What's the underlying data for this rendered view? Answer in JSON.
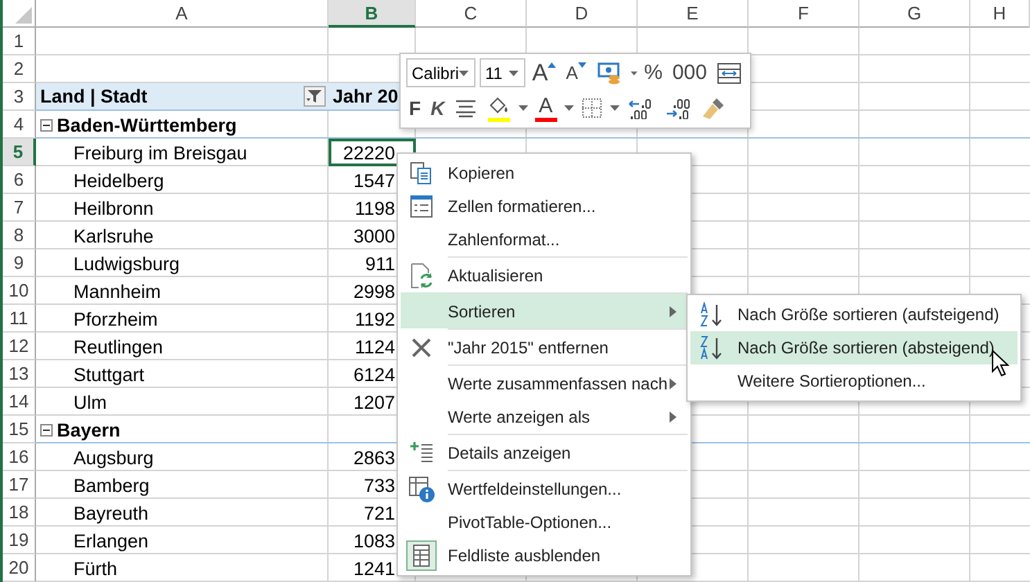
{
  "sheet": {
    "columns": [
      {
        "label": "A",
        "selected": false
      },
      {
        "label": "B",
        "selected": true
      },
      {
        "label": "C",
        "selected": false
      },
      {
        "label": "D",
        "selected": false
      },
      {
        "label": "E",
        "selected": false
      },
      {
        "label": "F",
        "selected": false
      },
      {
        "label": "G",
        "selected": false
      },
      {
        "label": "H",
        "selected": false
      }
    ],
    "rows": [
      {
        "number": "1",
        "kind": "blank",
        "selected": false
      },
      {
        "number": "2",
        "kind": "blank",
        "selected": false
      },
      {
        "number": "3",
        "kind": "header",
        "selected": false,
        "label": "Land | Stadt",
        "value": "Jahr 20"
      },
      {
        "number": "4",
        "kind": "group",
        "selected": false,
        "label": "Baden-Württemberg",
        "expanded": true
      },
      {
        "number": "5",
        "kind": "item",
        "selected": true,
        "label": "Freiburg im Breisgau",
        "value": "22220"
      },
      {
        "number": "6",
        "kind": "item",
        "selected": false,
        "label": "Heidelberg",
        "value": "1547"
      },
      {
        "number": "7",
        "kind": "item",
        "selected": false,
        "label": "Heilbronn",
        "value": "1198"
      },
      {
        "number": "8",
        "kind": "item",
        "selected": false,
        "label": "Karlsruhe",
        "value": "3000"
      },
      {
        "number": "9",
        "kind": "item",
        "selected": false,
        "label": "Ludwigsburg",
        "value": "911"
      },
      {
        "number": "10",
        "kind": "item",
        "selected": false,
        "label": "Mannheim",
        "value": "2998"
      },
      {
        "number": "11",
        "kind": "item",
        "selected": false,
        "label": "Pforzheim",
        "value": "1192"
      },
      {
        "number": "12",
        "kind": "item",
        "selected": false,
        "label": "Reutlingen",
        "value": "1124"
      },
      {
        "number": "13",
        "kind": "item",
        "selected": false,
        "label": "Stuttgart",
        "value": "6124"
      },
      {
        "number": "14",
        "kind": "item",
        "selected": false,
        "label": "Ulm",
        "value": "1207"
      },
      {
        "number": "15",
        "kind": "group",
        "selected": false,
        "label": "Bayern",
        "expanded": true
      },
      {
        "number": "16",
        "kind": "item",
        "selected": false,
        "label": "Augsburg",
        "value": "2863"
      },
      {
        "number": "17",
        "kind": "item",
        "selected": false,
        "label": "Bamberg",
        "value": "733"
      },
      {
        "number": "18",
        "kind": "item",
        "selected": false,
        "label": "Bayreuth",
        "value": "721"
      },
      {
        "number": "19",
        "kind": "item",
        "selected": false,
        "label": "Erlangen",
        "value": "1083"
      },
      {
        "number": "20",
        "kind": "item",
        "selected": false,
        "label": "Fürth",
        "value": "1241"
      }
    ]
  },
  "mini_toolbar": {
    "top_row": [
      {
        "kind": "font",
        "value": "Calibri"
      },
      {
        "kind": "size",
        "value": "11"
      },
      {
        "kind": "grow",
        "label": "A"
      },
      {
        "kind": "shrink",
        "label": "A"
      },
      {
        "kind": "number-format"
      },
      {
        "kind": "text",
        "label": "%"
      },
      {
        "kind": "text",
        "label": "000"
      },
      {
        "kind": "merge"
      }
    ],
    "bottom_row": [
      {
        "kind": "bold",
        "label": "F"
      },
      {
        "kind": "italic",
        "label": "K"
      },
      {
        "kind": "align"
      },
      {
        "kind": "fill",
        "color": "#ffff00"
      },
      {
        "kind": "font-color",
        "label": "A",
        "color": "#ff0000"
      },
      {
        "kind": "borders"
      },
      {
        "kind": "more-decimals"
      },
      {
        "kind": "fewer-decimals"
      },
      {
        "kind": "painter"
      }
    ]
  },
  "context_menu": {
    "items": [
      {
        "label": "Kopieren",
        "kind": "copy",
        "selected": false,
        "separator_before": false,
        "submenu": false
      },
      {
        "label": "Zellen formatieren...",
        "kind": "format",
        "selected": false,
        "separator_before": false,
        "submenu": false
      },
      {
        "label": "Zahlenformat...",
        "kind": "plain",
        "selected": false,
        "separator_before": false,
        "submenu": false
      },
      {
        "label": "Aktualisieren",
        "kind": "refresh",
        "selected": false,
        "separator_before": true,
        "submenu": false
      },
      {
        "label": "Sortieren",
        "kind": "plain",
        "selected": true,
        "separator_before": true,
        "submenu": true
      },
      {
        "label": "\"Jahr 2015\" entfernen",
        "kind": "remove",
        "selected": false,
        "separator_before": true,
        "submenu": false
      },
      {
        "label": "Werte zusammenfassen nach",
        "kind": "plain",
        "selected": false,
        "separator_before": true,
        "submenu": true
      },
      {
        "label": "Werte anzeigen als",
        "kind": "plain",
        "selected": false,
        "separator_before": false,
        "submenu": true
      },
      {
        "label": "Details anzeigen",
        "kind": "details",
        "selected": false,
        "separator_before": true,
        "submenu": false
      },
      {
        "label": "Wertfeldeinstellungen...",
        "kind": "settings",
        "selected": false,
        "separator_before": true,
        "submenu": false
      },
      {
        "label": "PivotTable-Optionen...",
        "kind": "plain",
        "selected": false,
        "separator_before": false,
        "submenu": false
      },
      {
        "label": "Feldliste ausblenden",
        "kind": "fieldlist",
        "selected": false,
        "separator_before": false,
        "submenu": false
      }
    ]
  },
  "submenu": {
    "items": [
      {
        "label": "Nach Größe sortieren (aufsteigend)",
        "kind": "sort-asc",
        "selected": false
      },
      {
        "label": "Nach Größe sortieren (absteigend)",
        "kind": "sort-desc",
        "selected": true
      },
      {
        "label": "Weitere Sortieroptionen...",
        "kind": "plain",
        "selected": false
      }
    ]
  }
}
